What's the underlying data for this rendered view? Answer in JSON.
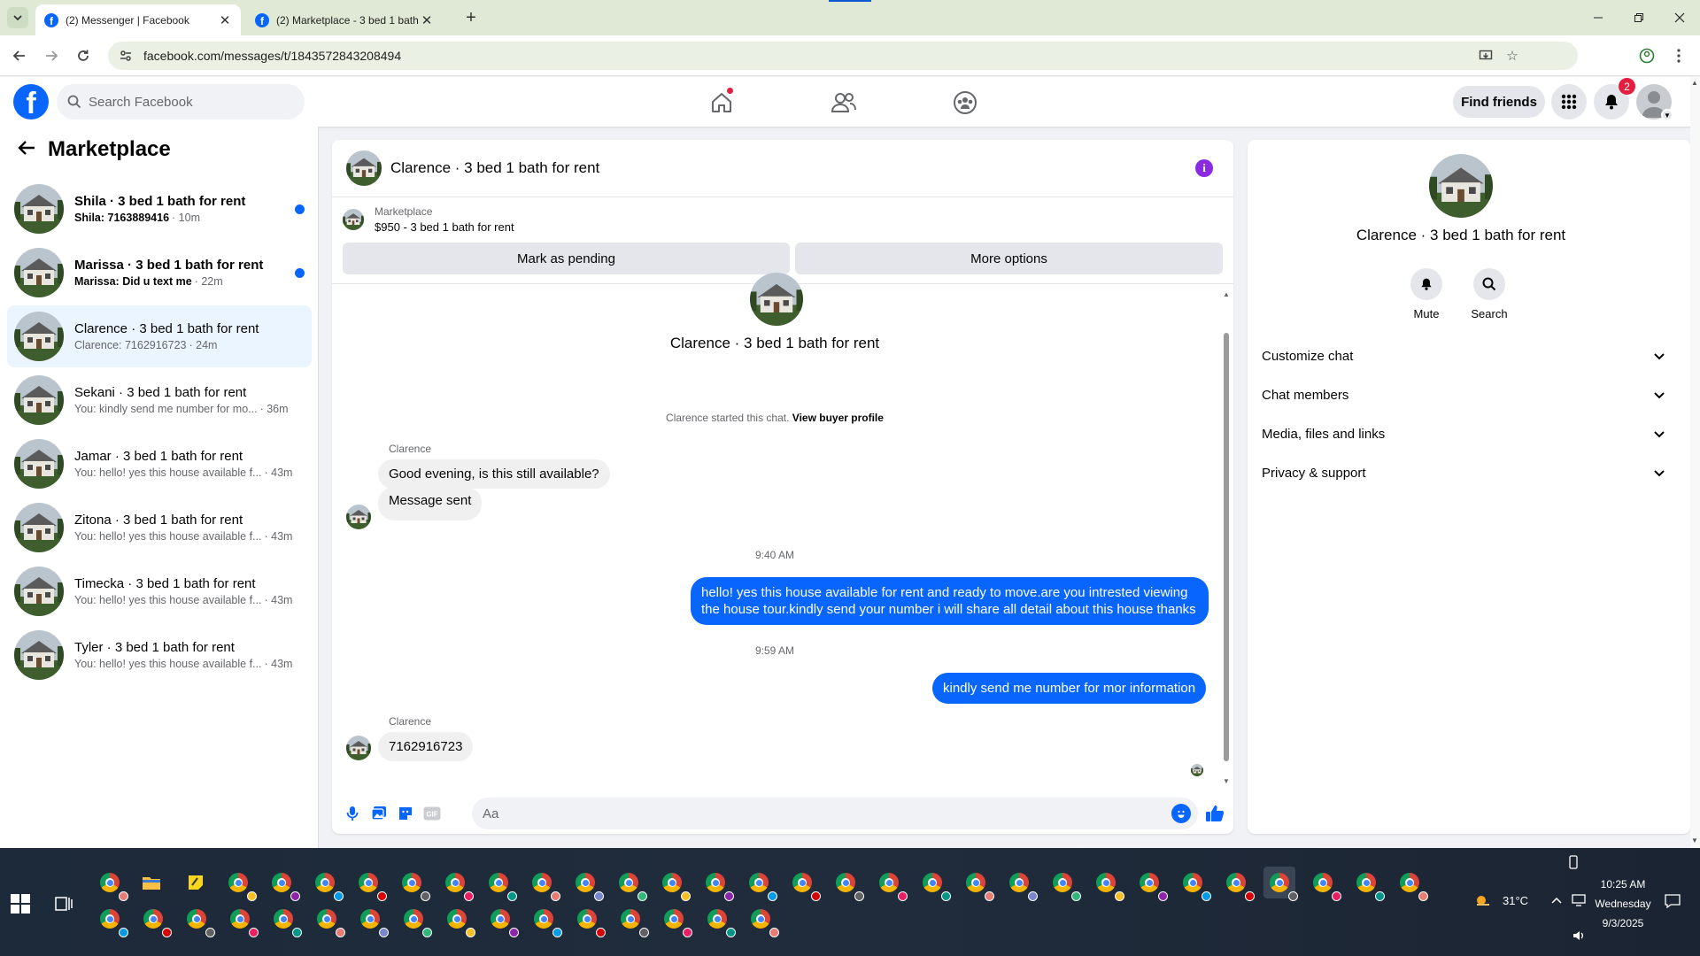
{
  "browser": {
    "tabs": [
      {
        "label": "(2) Messenger | Facebook",
        "active": true
      },
      {
        "label": "(2) Marketplace - 3 bed 1 bath",
        "active": false
      }
    ],
    "url": "facebook.com/messages/t/1843572843208494"
  },
  "header": {
    "logo": "f",
    "search_placeholder": "Search Facebook",
    "find_friends": "Find friends",
    "notification_count": "2",
    "icons": [
      "home-icon",
      "friends-icon",
      "groups-icon",
      "menu-grid-icon",
      "bell-icon",
      "profile-icon"
    ]
  },
  "sidebar": {
    "title": "Marketplace",
    "conversations": [
      {
        "name": "Shila · 3 bed 1 bath for rent",
        "preview": "Shila: 7163889416",
        "time": "· 10m",
        "unread": true
      },
      {
        "name": "Marissa · 3 bed 1 bath for rent",
        "preview": "Marissa: Did u text me",
        "time": "· 22m",
        "unread": true
      },
      {
        "name": "Clarence · 3 bed 1 bath for rent",
        "preview": "Clarence: 7162916723",
        "time": "· 24m",
        "unread": false,
        "selected": true
      },
      {
        "name": "Sekani · 3 bed 1 bath for rent",
        "preview": "You: kindly send me number for mo...",
        "time": "· 36m",
        "unread": false
      },
      {
        "name": "Jamar · 3 bed 1 bath for rent",
        "preview": "You: hello! yes this house available f...",
        "time": "· 43m",
        "unread": false
      },
      {
        "name": "Zitona · 3 bed 1 bath for rent",
        "preview": "You: hello! yes this house available f...",
        "time": "· 43m",
        "unread": false
      },
      {
        "name": "Timecka · 3 bed 1 bath for rent",
        "preview": "You: hello! yes this house available f...",
        "time": "· 43m",
        "unread": false
      },
      {
        "name": "Tyler · 3 bed 1 bath for rent",
        "preview": "You: hello! yes this house available f...",
        "time": "· 43m",
        "unread": false
      }
    ]
  },
  "chat": {
    "title": "Clarence · 3 bed 1 bath for rent",
    "marketplace_label": "Marketplace",
    "listing": "$950 - 3 bed 1 bath for rent",
    "mark_pending": "Mark as pending",
    "more_options": "More options",
    "intro_title": "Clarence · 3 bed 1 bath for rent",
    "started_text": "Clarence started this chat.",
    "view_profile": "View buyer profile",
    "sender": "Clarence",
    "msg1": "Good evening, is this still available?",
    "msg2": "Message sent",
    "time1": "9:40 AM",
    "out1": "hello! yes this house available for rent and ready to move.are you intrested viewing the house tour.kindly send your number i will share all detail about this house thanks",
    "time2": "9:59 AM",
    "out2": "kindly send me number for mor information",
    "msg3": "7162916723",
    "composer_placeholder": "Aa"
  },
  "info": {
    "title": "Clarence · 3 bed 1 bath for rent",
    "mute": "Mute",
    "search": "Search",
    "sections": [
      "Customize chat",
      "Chat members",
      "Media, files and links",
      "Privacy & support"
    ]
  },
  "taskbar": {
    "weather": "31°C",
    "time": "10:25 AM",
    "day": "Wednesday",
    "date": "9/3/2025"
  },
  "colors": {
    "fb_blue": "#0866ff",
    "selected_row": "#ebf5ff",
    "info_purple": "#8a2be2",
    "badge_red": "#e41e3f"
  }
}
